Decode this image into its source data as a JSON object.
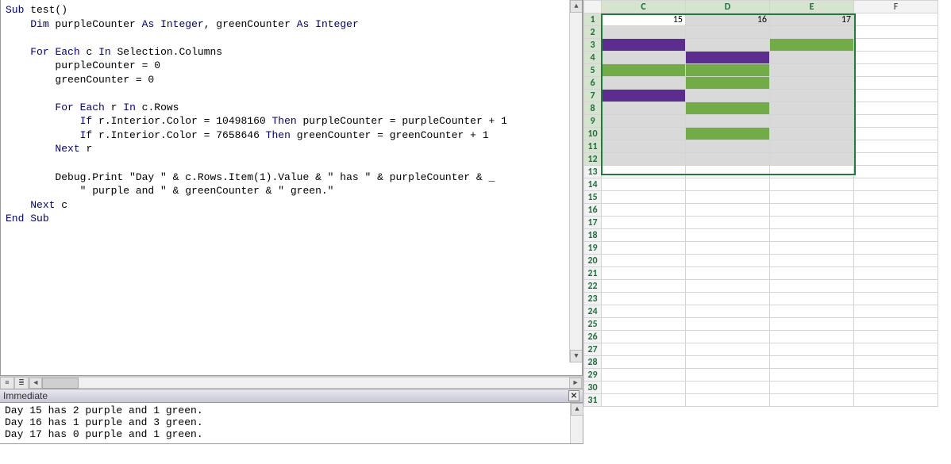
{
  "code": {
    "lines": [
      [
        [
          "kw",
          "Sub"
        ],
        [
          "",
          " test()"
        ]
      ],
      [
        [
          "",
          "    "
        ],
        [
          "kw",
          "Dim"
        ],
        [
          "",
          " purpleCounter "
        ],
        [
          "kw",
          "As"
        ],
        [
          "",
          " "
        ],
        [
          "kw",
          "Integer"
        ],
        [
          "",
          ", greenCounter "
        ],
        [
          "kw",
          "As"
        ],
        [
          "",
          " "
        ],
        [
          "kw",
          "Integer"
        ]
      ],
      [
        [
          "",
          ""
        ]
      ],
      [
        [
          "",
          "    "
        ],
        [
          "kw",
          "For"
        ],
        [
          "",
          " "
        ],
        [
          "kw",
          "Each"
        ],
        [
          "",
          " c "
        ],
        [
          "kw",
          "In"
        ],
        [
          "",
          " Selection.Columns"
        ]
      ],
      [
        [
          "",
          "        purpleCounter = 0"
        ]
      ],
      [
        [
          "",
          "        greenCounter = 0"
        ]
      ],
      [
        [
          "",
          ""
        ]
      ],
      [
        [
          "",
          "        "
        ],
        [
          "kw",
          "For"
        ],
        [
          "",
          " "
        ],
        [
          "kw",
          "Each"
        ],
        [
          "",
          " r "
        ],
        [
          "kw",
          "In"
        ],
        [
          "",
          " c.Rows"
        ]
      ],
      [
        [
          "",
          "            "
        ],
        [
          "kw",
          "If"
        ],
        [
          "",
          " r.Interior.Color = 10498160 "
        ],
        [
          "kw",
          "Then"
        ],
        [
          "",
          " purpleCounter = purpleCounter + 1"
        ]
      ],
      [
        [
          "",
          "            "
        ],
        [
          "kw",
          "If"
        ],
        [
          "",
          " r.Interior.Color = 7658646 "
        ],
        [
          "kw",
          "Then"
        ],
        [
          "",
          " greenCounter = greenCounter + 1"
        ]
      ],
      [
        [
          "",
          "        "
        ],
        [
          "kw",
          "Next"
        ],
        [
          "",
          " r"
        ]
      ],
      [
        [
          "",
          ""
        ]
      ],
      [
        [
          "",
          "        Debug.Print \"Day \" & c.Rows.Item(1).Value & \" has \" & purpleCounter & _"
        ]
      ],
      [
        [
          "",
          "            \" purple and \" & greenCounter & \" green.\""
        ]
      ],
      [
        [
          "",
          "    "
        ],
        [
          "kw",
          "Next"
        ],
        [
          "",
          " c"
        ]
      ],
      [
        [
          "kw",
          "End"
        ],
        [
          "",
          " "
        ],
        [
          "kw",
          "Sub"
        ]
      ]
    ]
  },
  "immediate": {
    "title": "Immediate",
    "lines": [
      "Day 15 has 2 purple and 1 green.",
      "Day 16 has 1 purple and 3 green.",
      "Day 17 has 0 purple and 1 green."
    ]
  },
  "sheet": {
    "cols": [
      "C",
      "D",
      "E",
      "F"
    ],
    "sel_cols": [
      0,
      1,
      2
    ],
    "rows": 31,
    "sel_rows_start": 1,
    "sel_rows_end": 12,
    "row1": {
      "C": "15",
      "D": "16",
      "E": "17"
    },
    "fills": {
      "3": {
        "C": "purple",
        "D": "selgrey",
        "E": "green"
      },
      "4": {
        "C": "selgrey",
        "D": "purple",
        "E": "selgrey"
      },
      "5": {
        "C": "green",
        "D": "green",
        "E": "selgrey"
      },
      "6": {
        "C": "selgrey",
        "D": "green",
        "E": "selgrey"
      },
      "7": {
        "C": "purple",
        "D": "selgrey",
        "E": "selgrey"
      },
      "8": {
        "C": "selgrey",
        "D": "green",
        "E": "selgrey"
      },
      "10": {
        "C": "selgrey",
        "D": "green",
        "E": "selgrey"
      }
    }
  }
}
